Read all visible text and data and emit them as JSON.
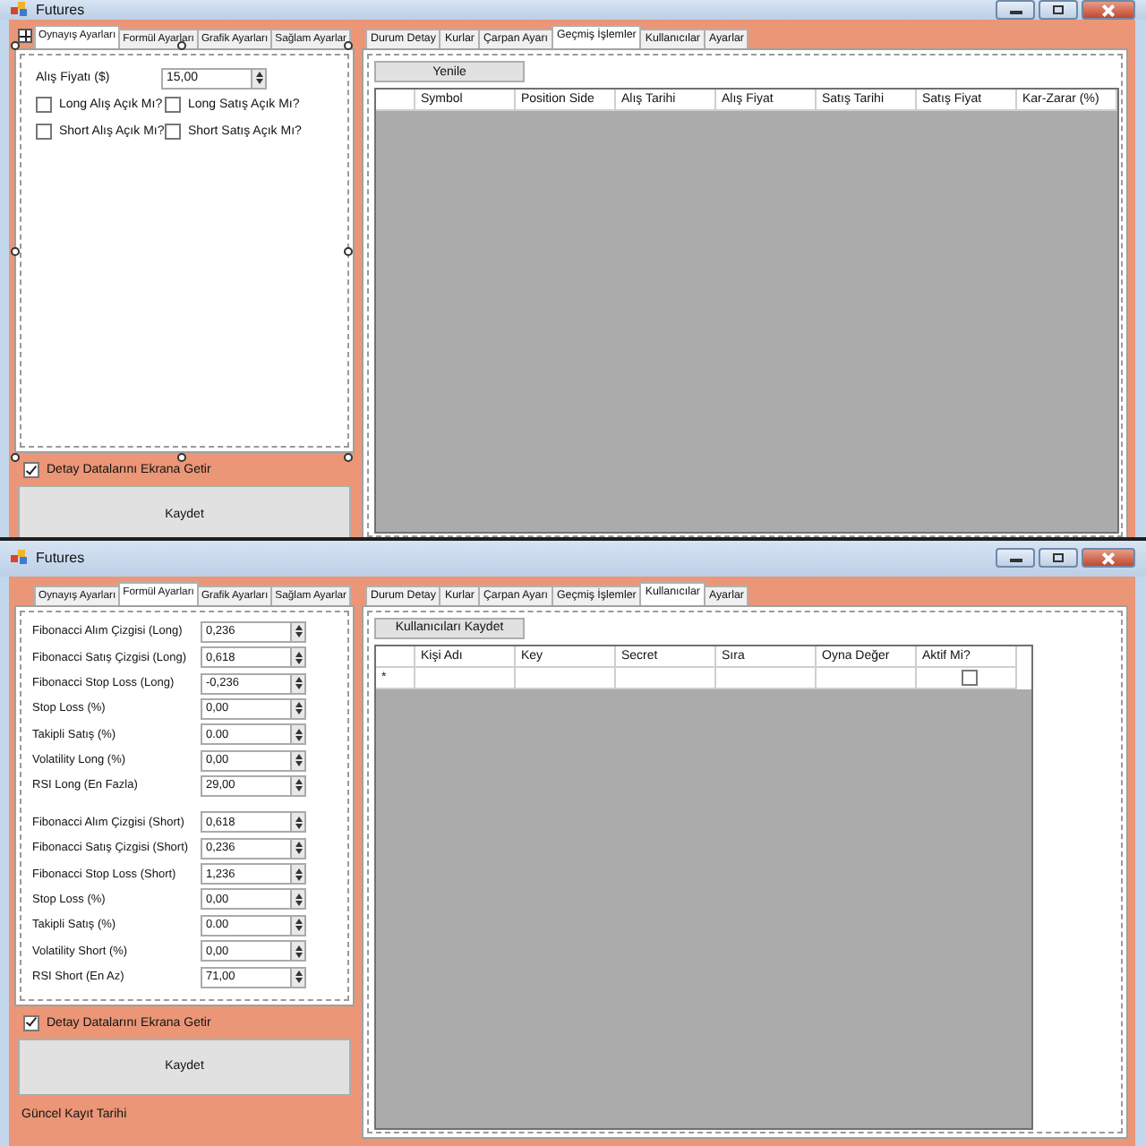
{
  "windows": [
    {
      "title": "Futures",
      "designer_selection": true,
      "left_tabs": [
        {
          "label": "Oynayış Ayarları",
          "selected": true
        },
        {
          "label": "Formül Ayarları",
          "selected": false
        },
        {
          "label": "Grafik Ayarları",
          "selected": false
        },
        {
          "label": "Sağlam Ayarlar",
          "selected": false
        }
      ],
      "left_panel": {
        "kind": "general",
        "fields": [
          {
            "label": "Alış Fiyatı ($)",
            "value": "15,00"
          }
        ],
        "checkboxes": [
          {
            "label": "Long Alış Açık Mı?",
            "checked": false
          },
          {
            "label": "Long Satış Açık Mı?",
            "checked": false
          },
          {
            "label": "Short Alış Açık Mı?",
            "checked": false
          },
          {
            "label": "Short Satış Açık Mı?",
            "checked": false
          }
        ]
      },
      "detail_toggle": {
        "label": "Detay Datalarını Ekrana Getir",
        "checked": true
      },
      "save_button": "Kaydet",
      "right_tabs": [
        {
          "label": "Durum Detay",
          "selected": false
        },
        {
          "label": "Kurlar",
          "selected": false
        },
        {
          "label": "Çarpan Ayarı",
          "selected": false
        },
        {
          "label": "Geçmiş İşlemler",
          "selected": true
        },
        {
          "label": "Kullanıcılar",
          "selected": false
        },
        {
          "label": "Ayarlar",
          "selected": false
        }
      ],
      "action_button": "Yenile",
      "grid": {
        "columns": [
          {
            "label": "Symbol",
            "kind": "text"
          },
          {
            "label": "Position Side",
            "kind": "text"
          },
          {
            "label": "Alış Tarihi",
            "kind": "text"
          },
          {
            "label": "Alış Fiyat",
            "kind": "text"
          },
          {
            "label": "Satış Tarihi",
            "kind": "text"
          },
          {
            "label": "Satış Fiyat",
            "kind": "text"
          },
          {
            "label": "Kar-Zarar (%)",
            "kind": "text"
          }
        ]
      }
    },
    {
      "title": "Futures",
      "left_tabs": [
        {
          "label": "Oynayış Ayarları",
          "selected": false
        },
        {
          "label": "Formül Ayarları",
          "selected": true
        },
        {
          "label": "Grafik Ayarları",
          "selected": false
        },
        {
          "label": "Sağlam Ayarlar",
          "selected": false
        }
      ],
      "left_panel": {
        "kind": "formula",
        "groups": [
          [
            {
              "label": "Fibonacci Alım Çizgisi (Long)",
              "value": "0,236"
            },
            {
              "label": "Fibonacci Satış Çizgisi (Long)",
              "value": "0,618"
            },
            {
              "label": "Fibonacci Stop Loss (Long)",
              "value": "-0,236"
            },
            {
              "label": "Stop Loss (%)",
              "value": "0,00"
            },
            {
              "label": "Takipli Satış (%)",
              "value": "0.00"
            },
            {
              "label": "Volatility Long (%)",
              "value": "0,00"
            },
            {
              "label": "RSI Long (En Fazla)",
              "value": "29,00"
            }
          ],
          [
            {
              "label": "Fibonacci Alım Çizgisi (Short)",
              "value": "0,618"
            },
            {
              "label": "Fibonacci Satış Çizgisi (Short)",
              "value": "0,236"
            },
            {
              "label": "Fibonacci Stop Loss (Short)",
              "value": "1,236"
            },
            {
              "label": "Stop Loss (%)",
              "value": "0,00"
            },
            {
              "label": "Takipli Satış (%)",
              "value": "0.00"
            },
            {
              "label": "Volatility Short (%)",
              "value": "0,00"
            },
            {
              "label": "RSI Short (En Az)",
              "value": "71,00"
            }
          ]
        ]
      },
      "detail_toggle": {
        "label": "Detay Datalarını Ekrana Getir",
        "checked": true
      },
      "save_button": "Kaydet",
      "status_label": "Güncel Kayıt Tarihi",
      "right_tabs": [
        {
          "label": "Durum Detay",
          "selected": false
        },
        {
          "label": "Kurlar",
          "selected": false
        },
        {
          "label": "Çarpan Ayarı",
          "selected": false
        },
        {
          "label": "Geçmiş İşlemler",
          "selected": false
        },
        {
          "label": "Kullanıcılar",
          "selected": true
        },
        {
          "label": "Ayarlar",
          "selected": false
        }
      ],
      "action_button": "Kullanıcıları Kaydet",
      "grid": {
        "columns": [
          {
            "label": "Kişi Adı",
            "kind": "text"
          },
          {
            "label": "Key",
            "kind": "text"
          },
          {
            "label": "Secret",
            "kind": "text"
          },
          {
            "label": "Sıra",
            "kind": "text"
          },
          {
            "label": "Oyna Değer",
            "kind": "text"
          },
          {
            "label": "Aktif Mi?",
            "kind": "checkbox"
          }
        ],
        "rows": [
          {
            "marker": "*",
            "checked": false
          }
        ]
      }
    }
  ]
}
